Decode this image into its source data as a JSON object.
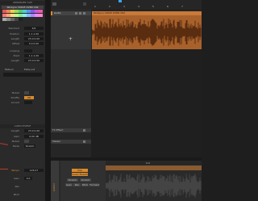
{
  "inspector": {
    "title": "ARRANGER CLIP",
    "clip_name": "Winkyou VOICE OVER V02",
    "fields": [
      {
        "label": "Standard",
        "value": "4/4"
      },
      {
        "label": "Position",
        "value": "1.1.1.00"
      },
      {
        "label": "Length",
        "value": "23.0.0.00"
      },
      {
        "label": "Offset",
        "value": "0.0.0.00"
      },
      {
        "label": "Looping",
        "value": ""
      },
      {
        "label": "Start",
        "value": "1.1.1.00"
      },
      {
        "label": "Length",
        "value": "23.0.0.00"
      },
      {
        "label": "Fade-in",
        "value": "Fade-out"
      }
    ],
    "muted_label": "Muted",
    "shuffle_label": "Shuffle",
    "shuffle_value": "ON",
    "accent_label": "Accent",
    "audio_event_title": "AUDIO EVENT",
    "audio_fields": [
      {
        "label": "Length",
        "value": "23.0.0.00"
      },
      {
        "label": "Gain",
        "value": "0.00 dB"
      },
      {
        "label": "Muted",
        "value": ""
      },
      {
        "label": "Mode",
        "value": "Stretch"
      }
    ],
    "tempo_label": "Tempo",
    "tempo_value": "126.27",
    "bottom_fields": [
      {
        "label": "Gain",
        "value": "0.0"
      },
      {
        "label": "Pan",
        "value": ""
      },
      {
        "label": "Pitch",
        "value": ""
      }
    ]
  },
  "tracks": {
    "audio_label": "Audio",
    "fx_label": "FX Effect",
    "master_label": "Master"
  },
  "ruler": {
    "numbers": [
      "1",
      "2",
      "3",
      "4",
      "5",
      "6",
      "7"
    ]
  },
  "clip": {
    "name": "Winkyou VOICE OVER V02"
  },
  "detail": {
    "tabs": [
      "Clip",
      "Audio Events"
    ],
    "buttons": [
      "Stretch",
      "Stretch"
    ],
    "mini_buttons": [
      "Gain",
      "Pan",
      "Pitch",
      "Formant"
    ],
    "track_label": "AUDIO",
    "ruler_label": "0.0"
  },
  "colors": {
    "accent": "#d98a2b",
    "waveform_bg": "#a8612b",
    "waveform": "#5a2d10",
    "detail_wave": "#444444",
    "swatches": [
      "#e55",
      "#e85",
      "#ec5",
      "#9d5",
      "#5c7",
      "#5cc",
      "#59e",
      "#85e",
      "#c5d",
      "#e5a",
      "#f77",
      "#fa7",
      "#fd8",
      "#bf8",
      "#8e9",
      "#8ee",
      "#8bf",
      "#a8f",
      "#e8f",
      "#f8c",
      "#aaa",
      "#888",
      "#666",
      "#444",
      "#222"
    ]
  }
}
